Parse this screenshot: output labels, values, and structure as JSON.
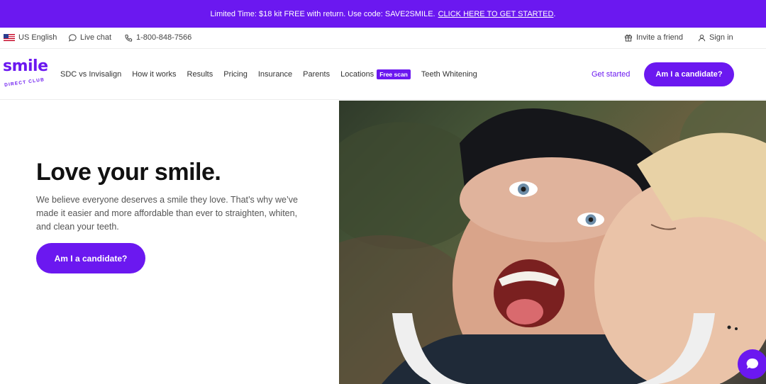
{
  "promo": {
    "text": "Limited Time: $18 kit FREE with return. Use code: SAVE2SMILE.",
    "link": "CLICK HERE TO GET STARTED",
    "period": "."
  },
  "utility": {
    "language": "US English",
    "live_chat": "Live chat",
    "phone": "1-800-848-7566",
    "invite": "Invite a friend",
    "sign_in": "Sign in"
  },
  "logo": {
    "word": "smile",
    "sub": "DIRECT CLUB"
  },
  "nav": {
    "links": [
      "SDC vs Invisalign",
      "How it works",
      "Results",
      "Pricing",
      "Insurance",
      "Parents"
    ],
    "locations": "Locations",
    "free_scan": "Free scan",
    "teeth_whitening": "Teeth Whitening",
    "get_started": "Get started",
    "candidate": "Am I a candidate?"
  },
  "hero": {
    "title": "Love your smile.",
    "description": "We believe everyone deserves a smile they love. That’s why we’ve made it easier and more affordable than ever to straighten, whiten, and clean your teeth.",
    "cta": "Am I a candidate?"
  },
  "colors": {
    "brand": "#6b18f0"
  },
  "icons": [
    "us-flag-icon",
    "chat-icon",
    "phone-icon",
    "gift-icon",
    "user-icon",
    "chat-bubble-icon"
  ]
}
